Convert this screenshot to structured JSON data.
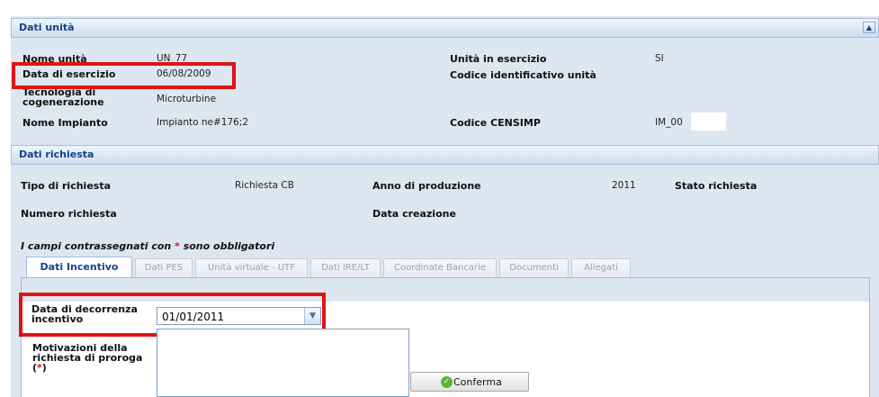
{
  "dati_unita": {
    "title": "Dati unità",
    "fields": {
      "nome_unita": {
        "label": "Nome unità",
        "value": "UN_77"
      },
      "data_esercizio": {
        "label": "Data di esercizio",
        "value": "06/08/2009"
      },
      "tecnologia": {
        "label_line1": "Tecnologia di",
        "label_line2": "cogenerazione",
        "value": "Microturbine"
      },
      "nome_impianto": {
        "label": "Nome Impianto",
        "value": "Impianto ne#176;2"
      },
      "unita_esercizio": {
        "label": "Unità in esercizio",
        "value": "SI"
      },
      "codice_id": {
        "label": "Codice identificativo unità",
        "value": ""
      },
      "codice_censimp": {
        "label": "Codice CENSIMP",
        "value": "IM_00"
      }
    }
  },
  "dati_richiesta": {
    "title": "Dati richiesta",
    "tipo": {
      "label": "Tipo di richiesta",
      "value": "Richiesta CB"
    },
    "anno": {
      "label": "Anno di produzione",
      "value": "2011"
    },
    "stato": {
      "label": "Stato richiesta",
      "value": ""
    },
    "numero": {
      "label": "Numero richiesta",
      "value": ""
    },
    "creazione": {
      "label": "Data creazione",
      "value": ""
    },
    "note_prefix": "I campi contrassegnati con ",
    "note_star": "*",
    "note_suffix": " sono obbligatori"
  },
  "tabs": [
    {
      "label": "Dati Incentivo",
      "active": true
    },
    {
      "label": "Dati PES"
    },
    {
      "label": "Unità virtuale - UTF"
    },
    {
      "label": "Dati IRE/LT"
    },
    {
      "label": "Coordinate Bancarie"
    },
    {
      "label": "Documenti"
    },
    {
      "label": "Allegati"
    }
  ],
  "form": {
    "decorrenza": {
      "label_line1": "Data di decorrenza",
      "label_line2": "incentivo",
      "value": "01/01/2011"
    },
    "motivazioni": {
      "label_line1": "Motivazioni della",
      "label_line2": "richiesta di proroga",
      "label_open": "(",
      "label_star": "*",
      "label_close": ")",
      "value": ""
    },
    "confirm_label": "Conferma"
  },
  "colors": {
    "header_text": "#15428b",
    "highlight_border": "#e01414",
    "required_star": "#e01414"
  },
  "icons": [
    "collapse-up-icon",
    "chevron-down-icon",
    "confirm-check-icon"
  ]
}
